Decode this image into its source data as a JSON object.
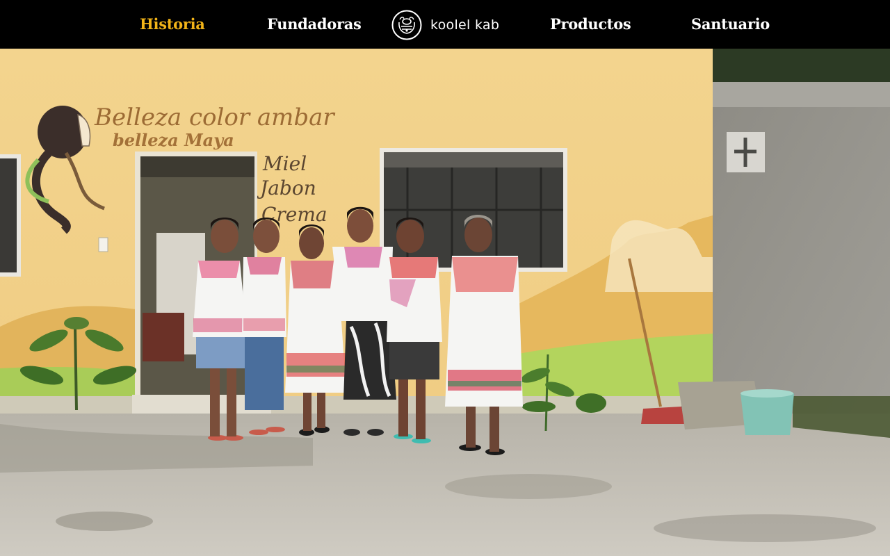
{
  "nav": {
    "items": [
      {
        "label": "Historia",
        "active": true
      },
      {
        "label": "Fundadoras",
        "active": false
      },
      {
        "label": "Productos",
        "active": false
      },
      {
        "label": "Santuario",
        "active": false
      }
    ],
    "logo_text": "koolel kab",
    "active_color": "#f2b418"
  },
  "hero": {
    "wall_text": {
      "line1": "Belleza color ambar",
      "line2": "belleza Maya",
      "line3": "Miel",
      "line4": "Jabon",
      "line5": "Crema"
    },
    "women": [
      {
        "name": "woman-1"
      },
      {
        "name": "woman-2"
      },
      {
        "name": "woman-3"
      },
      {
        "name": "woman-4"
      },
      {
        "name": "woman-5"
      },
      {
        "name": "woman-6"
      }
    ]
  }
}
